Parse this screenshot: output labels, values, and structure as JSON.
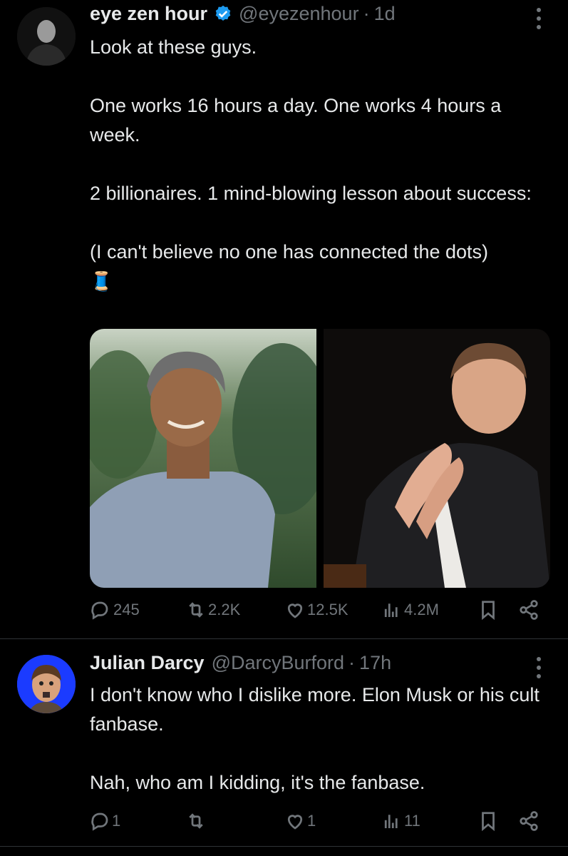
{
  "tweets": [
    {
      "name": "eye zen hour",
      "handle": "@eyezenhour",
      "separator": "·",
      "time": "1d",
      "paragraphs": [
        "Look at these guys.",
        "One works 16 hours a day. One works 4 hours a week.",
        "2 billionaires. 1 mind-blowing lesson about success:",
        "(I can't believe no one has connected the dots)"
      ],
      "emoji": "🧵",
      "stats": {
        "replies": "245",
        "reposts": "2.2K",
        "likes": "12.5K",
        "views": "4.2M"
      }
    },
    {
      "name": "Julian Darcy",
      "handle": "@DarcyBurford",
      "separator": "·",
      "time": "17h",
      "paragraphs": [
        "I don't know who I dislike more. Elon Musk or his cult fanbase.",
        "Nah, who am I kidding, it's the fanbase."
      ],
      "stats": {
        "replies": "1",
        "reposts": "",
        "likes": "1",
        "views": "11"
      }
    }
  ],
  "colors": {
    "background": "#000000",
    "text": "#e7e9ea",
    "muted": "#71767b",
    "verified": "#1d9bf0",
    "divider": "#2f3336"
  },
  "icons": [
    "verified-badge-icon",
    "more-icon",
    "reply-icon",
    "repost-icon",
    "like-icon",
    "views-icon",
    "bookmark-icon",
    "share-icon"
  ]
}
